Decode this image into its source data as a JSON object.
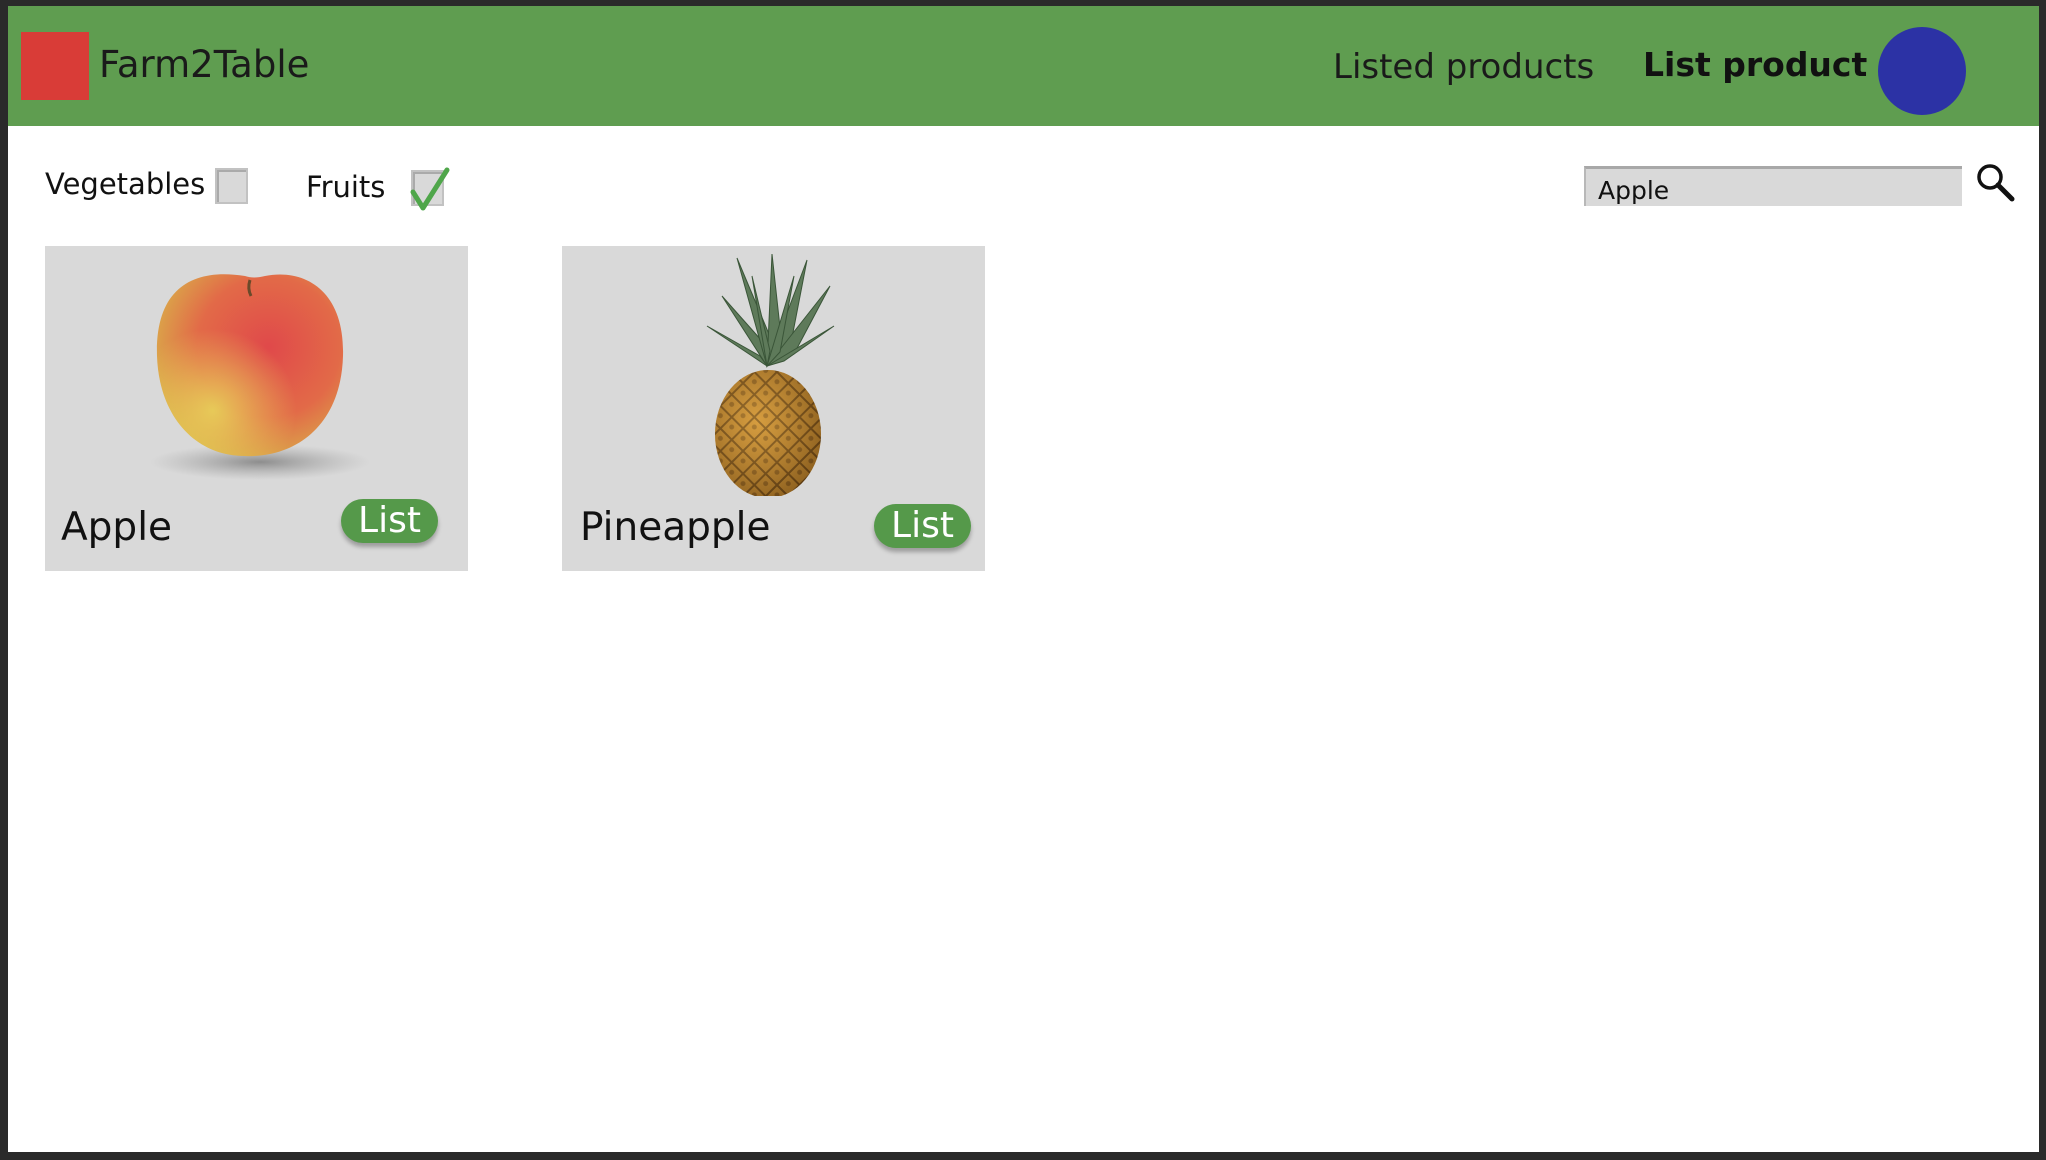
{
  "header": {
    "app_title": "Farm2Table",
    "nav": {
      "listed_products": "Listed products",
      "list_product": "List product"
    },
    "colors": {
      "header_bg": "#5f9d50",
      "logo": "#d93c37",
      "avatar": "#2c32a5"
    }
  },
  "filters": [
    {
      "label": "Vegetables",
      "checked": false
    },
    {
      "label": "Fruits",
      "checked": true
    }
  ],
  "search": {
    "value": "Apple",
    "icon": "search-icon"
  },
  "products": [
    {
      "name": "Apple",
      "button_label": "List",
      "image": "apple-image"
    },
    {
      "name": "Pineapple",
      "button_label": "List",
      "image": "pineapple-image"
    }
  ]
}
